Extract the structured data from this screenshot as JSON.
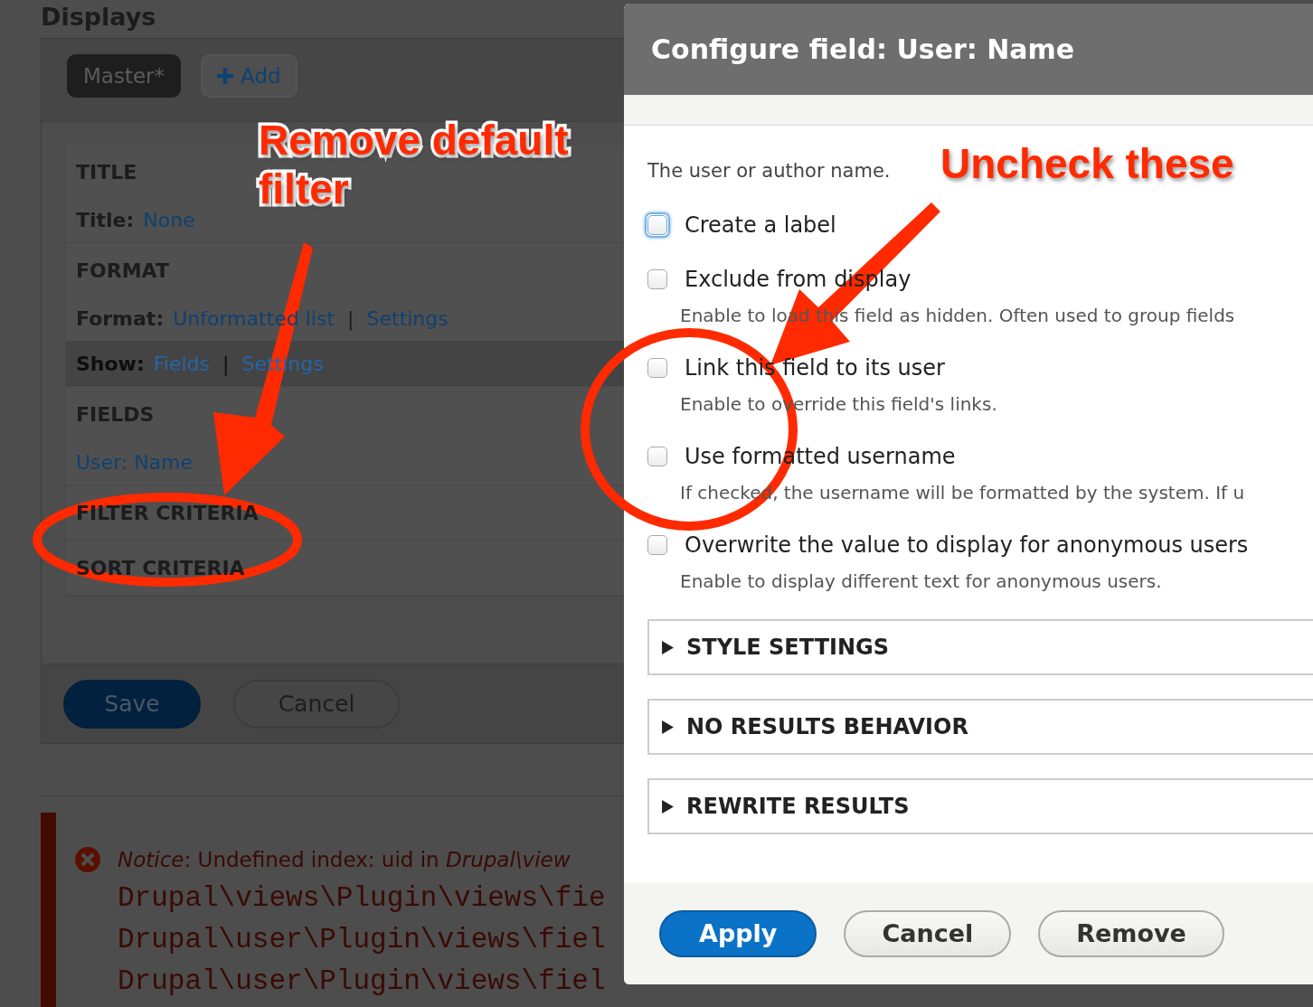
{
  "page": {
    "heading": "Displays",
    "tabs": [
      {
        "label": "Master*",
        "selected": true
      },
      {
        "label": "Add",
        "selected": false
      }
    ],
    "sections": [
      {
        "title": "TITLE",
        "rows": [
          {
            "label": "Title:",
            "links": [
              "None"
            ],
            "highlighted": false
          }
        ]
      },
      {
        "title": "FORMAT",
        "rows": [
          {
            "label": "Format:",
            "links": [
              "Unformatted list",
              "Settings"
            ],
            "separator": "|",
            "highlighted": false
          },
          {
            "label": "Show:",
            "links": [
              "Fields",
              "Settings"
            ],
            "separator": "|",
            "highlighted": true
          }
        ]
      },
      {
        "title": "FIELDS",
        "rows": [
          {
            "links": [
              "User: Name"
            ],
            "highlighted": false
          }
        ]
      },
      {
        "title": "FILTER CRITERIA"
      },
      {
        "title": "SORT CRITERIA"
      }
    ],
    "buttons": [
      {
        "label": "Save",
        "kind": "primary"
      },
      {
        "label": "Cancel",
        "kind": "secondary"
      }
    ],
    "error": {
      "message": "*Notice*: Undefined index: uid in *Drupal\\view*",
      "trace": [
        "Drupal\\views\\Plugin\\views\\fie",
        "Drupal\\user\\Plugin\\views\\fiel",
        "Drupal\\user\\Plugin\\views\\fiel"
      ]
    }
  },
  "dialog": {
    "title": "Configure field: User: Name",
    "description": "The user or author name.",
    "options": [
      {
        "label": "Create a label",
        "checked": false,
        "focused": true
      },
      {
        "label": "Exclude from display",
        "description": "Enable to load this field as hidden. Often used to group fields",
        "checked": false,
        "focused": false
      },
      {
        "label": "Link this field to its user",
        "description": "Enable to override this field's links.",
        "checked": false,
        "focused": false
      },
      {
        "label": "Use formatted username",
        "description": "If checked, the username will be formatted by the system. If u",
        "checked": false,
        "focused": false
      },
      {
        "label": "Overwrite the value to display for anonymous users",
        "description": "Enable to display different text for anonymous users.",
        "checked": false,
        "focused": false
      }
    ],
    "sections": [
      {
        "label": "STYLE SETTINGS",
        "expanded": false
      },
      {
        "label": "NO RESULTS BEHAVIOR",
        "expanded": false
      },
      {
        "label": "REWRITE RESULTS",
        "expanded": false
      }
    ],
    "buttons": [
      {
        "label": "Apply",
        "kind": "primary"
      },
      {
        "label": "Cancel",
        "kind": "secondary"
      },
      {
        "label": "Remove",
        "kind": "secondary"
      }
    ]
  },
  "annotations": [
    {
      "text": "Remove default filter"
    },
    {
      "text": "Uncheck these"
    }
  ]
}
